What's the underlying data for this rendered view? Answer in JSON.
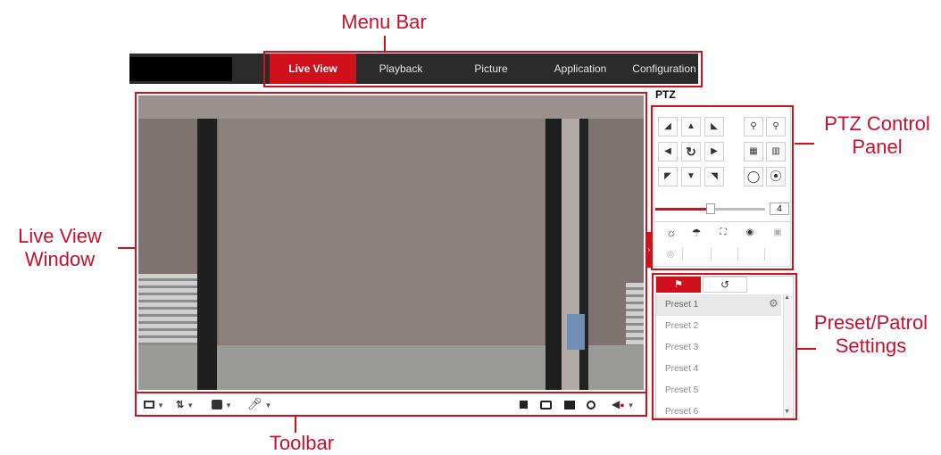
{
  "callouts": {
    "menu_bar": "Menu Bar",
    "live_view_window": [
      "Live View",
      "Window"
    ],
    "toolbar": "Toolbar",
    "ptz_control_panel": [
      "PTZ Control",
      "Panel"
    ],
    "preset_patrol": [
      "Preset/Patrol",
      "Settings"
    ]
  },
  "menu": {
    "items": [
      {
        "label": "Live View",
        "active": true
      },
      {
        "label": "Playback",
        "active": false
      },
      {
        "label": "Picture",
        "active": false
      },
      {
        "label": "Application",
        "active": false
      },
      {
        "label": "Configuration",
        "active": false
      }
    ]
  },
  "ptz": {
    "title": "PTZ",
    "direction_icons": [
      "up-left-arrow-icon",
      "up-arrow-icon",
      "up-right-arrow-icon",
      "left-arrow-icon",
      "auto-pan-icon",
      "right-arrow-icon",
      "down-left-arrow-icon",
      "down-arrow-icon",
      "down-right-arrow-icon"
    ],
    "lens_icons": [
      "zoom-in-icon",
      "zoom-out-icon",
      "focus-near-icon",
      "focus-far-icon",
      "iris-open-icon",
      "iris-close-icon"
    ],
    "speed": "4",
    "speed_fraction": 0.5,
    "aux_icons": [
      "light-icon",
      "wiper-icon",
      "one-touch-focus-icon",
      "lens-init-icon",
      "3d-positioning-icon"
    ],
    "extra_icon": "manual-tracking-icon"
  },
  "presets": {
    "tab_flag_icon": "preset-flag-icon",
    "tab_patrol_icon": "patrol-icon",
    "items": [
      "Preset 1",
      "Preset 2",
      "Preset 3",
      "Preset 4",
      "Preset 5",
      "Preset 6"
    ]
  },
  "toolbar": {
    "left_icons": [
      "window-division-icon",
      "stream-type-icon",
      "plugin-icon",
      "microphone-icon"
    ],
    "right_icons": [
      "stop-live-view-icon",
      "capture-icon",
      "record-icon",
      "digital-zoom-icon",
      "audio-icon"
    ]
  },
  "colors": {
    "accent": "#d0101b",
    "menu_bg": "#2b2b2b",
    "callout_text": "#c8102e"
  }
}
